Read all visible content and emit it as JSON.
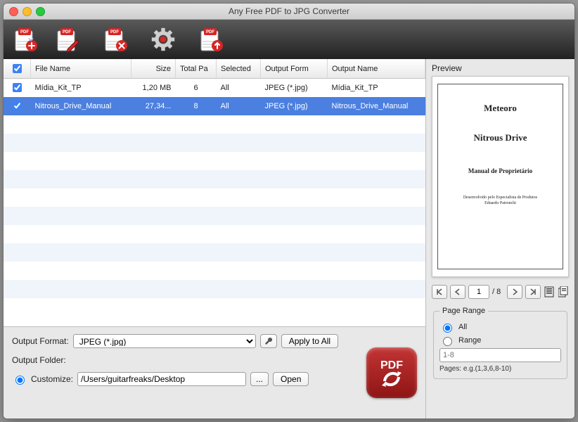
{
  "window": {
    "title": "Any Free PDF to JPG Converter"
  },
  "toolbar": {
    "add": "Add",
    "edit": "Edit",
    "remove": "Remove",
    "settings": "Settings",
    "convert": "Convert"
  },
  "table": {
    "headers": {
      "filename": "File Name",
      "size": "Size",
      "total": "Total Pa",
      "selected": "Selected",
      "format": "Output Form",
      "outname": "Output Name"
    },
    "rows": [
      {
        "checked": true,
        "selected": false,
        "name": "Mídia_Kit_TP",
        "size": "1,20 MB",
        "total": "6",
        "sel": "All",
        "format": "JPEG (*.jpg)",
        "outname": "Mídia_Kit_TP"
      },
      {
        "checked": true,
        "selected": true,
        "name": "Nitrous_Drive_Manual",
        "size": "27,34...",
        "total": "8",
        "sel": "All",
        "format": "JPEG (*.jpg)",
        "outname": "Nitrous_Drive_Manual"
      }
    ]
  },
  "output": {
    "format_label": "Output Format:",
    "format_value": "JPEG (*.jpg)",
    "apply_all": "Apply to All",
    "folder_label": "Output Folder:",
    "customize_label": "Customize:",
    "customize_value": "/Users/guitarfreaks/Desktop",
    "browse": "...",
    "open": "Open",
    "pdf_badge": "PDF"
  },
  "preview": {
    "label": "Preview",
    "doc_h1": "Meteoro",
    "doc_h2": "Nitrous Drive",
    "doc_h3": "Manual de Proprietário",
    "doc_small1": "Desenvolvido pelo Especialista de Produtos",
    "doc_small2": "Eduardo Patronchi",
    "page_current": "1",
    "page_sep": "/ 8"
  },
  "pagerange": {
    "legend": "Page Range",
    "all": "All",
    "range": "Range",
    "range_placeholder": "1-8",
    "hint": "Pages: e.g.(1,3,6,8-10)"
  }
}
